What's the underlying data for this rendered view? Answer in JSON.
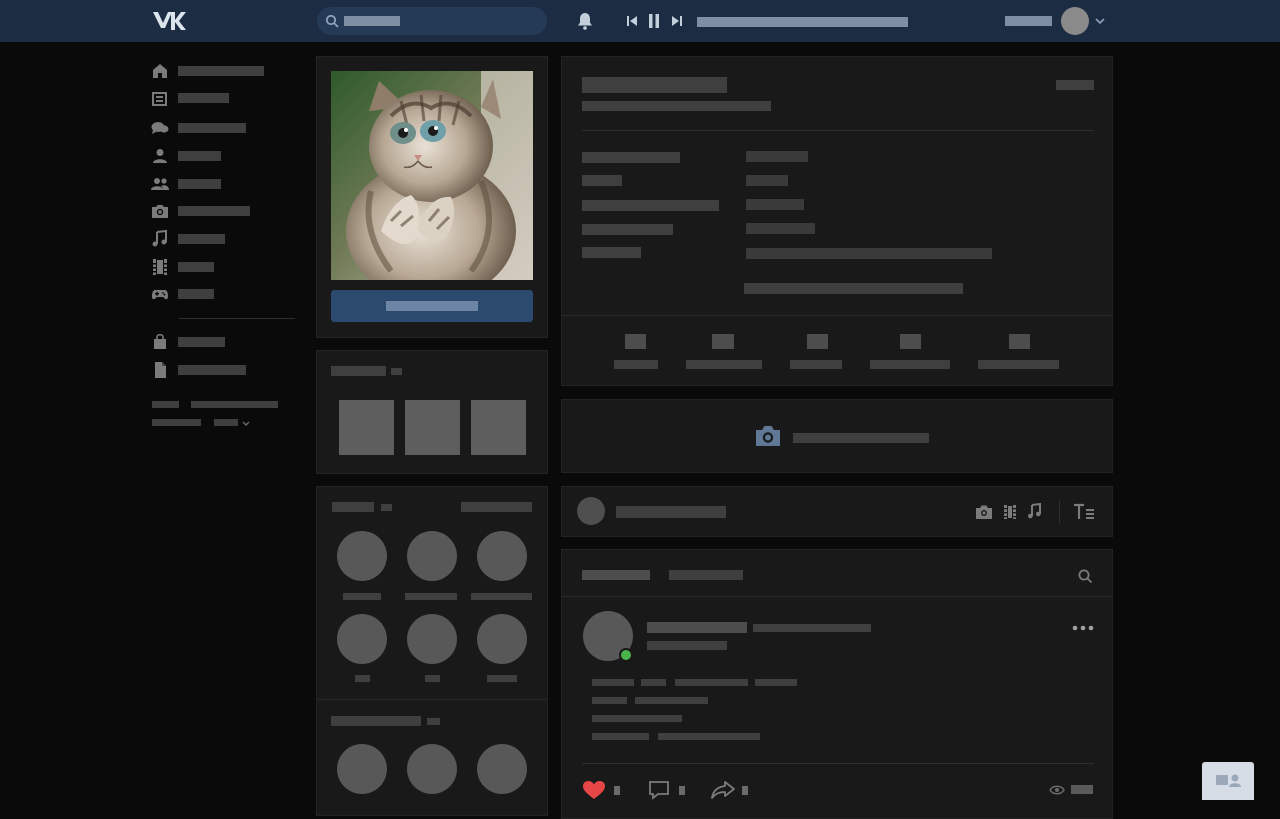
{
  "app": {
    "logo_icon": "vk-logo-icon"
  },
  "header": {
    "search_placeholder": "",
    "icons": [
      "search-icon",
      "bell-icon",
      "prev-track-icon",
      "pause-icon",
      "next-track-icon",
      "chevron-down-icon"
    ]
  },
  "sidebar": {
    "items": [
      {
        "icon": "home-icon"
      },
      {
        "icon": "news-icon"
      },
      {
        "icon": "messages-icon"
      },
      {
        "icon": "user-icon"
      },
      {
        "icon": "friends-icon"
      },
      {
        "icon": "camera-icon"
      },
      {
        "icon": "music-icon"
      },
      {
        "icon": "video-icon"
      },
      {
        "icon": "gamepad-icon"
      },
      {
        "icon": "shopping-bag-icon"
      },
      {
        "icon": "document-icon"
      }
    ]
  },
  "post_actions": {
    "like_icon": "heart-icon",
    "comment_icon": "comment-icon",
    "share_icon": "share-icon",
    "views_icon": "eye-icon"
  },
  "colors": {
    "topbar": "#1b2c43",
    "accent": "#4a76a8",
    "like": "#e64646",
    "online": "#4bb34b",
    "panel": "#191919"
  }
}
